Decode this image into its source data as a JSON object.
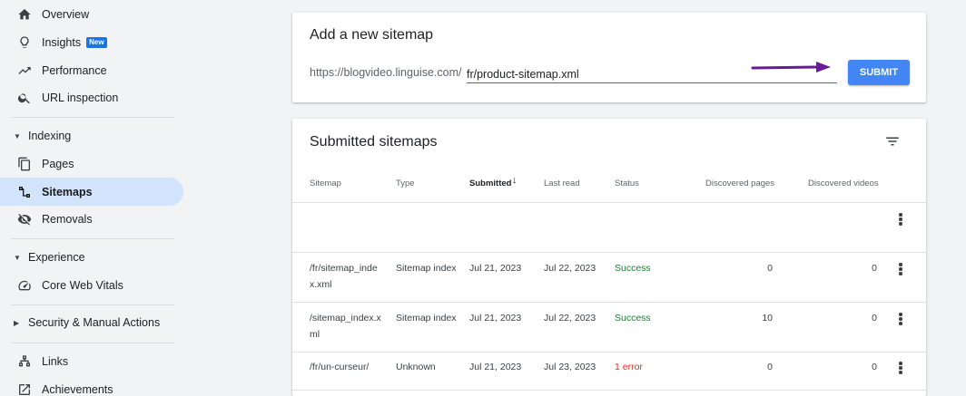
{
  "sidebar": {
    "overview": "Overview",
    "insights": "Insights",
    "insights_badge": "New",
    "performance": "Performance",
    "url_inspection": "URL inspection",
    "indexing": "Indexing",
    "pages": "Pages",
    "sitemaps": "Sitemaps",
    "removals": "Removals",
    "experience": "Experience",
    "core_web_vitals": "Core Web Vitals",
    "security": "Security & Manual Actions",
    "links": "Links",
    "achievements": "Achievements"
  },
  "add_sitemap": {
    "title": "Add a new sitemap",
    "prefix": "https://blogvideo.linguise.com/",
    "input_value": "fr/product-sitemap.xml",
    "submit_label": "SUBMIT"
  },
  "submitted": {
    "title": "Submitted sitemaps",
    "headers": {
      "sitemap": "Sitemap",
      "type": "Type",
      "submitted": "Submitted",
      "last_read": "Last read",
      "status": "Status",
      "discovered_pages": "Discovered pages",
      "discovered_videos": "Discovered videos"
    },
    "rows": [
      {
        "sitemap_line1": "/fr/sitemap_inde",
        "sitemap_line2": "x.xml",
        "type": "Sitemap index",
        "submitted": "Jul 21, 2023",
        "last_read": "Jul 22, 2023",
        "status": "Success",
        "pages": "0",
        "videos": "0"
      },
      {
        "sitemap_line1": "/sitemap_index.x",
        "sitemap_line2": "ml",
        "type": "Sitemap index",
        "submitted": "Jul 21, 2023",
        "last_read": "Jul 22, 2023",
        "status": "Success",
        "pages": "10",
        "videos": "0"
      },
      {
        "sitemap_line1": "/fr/un-curseur/",
        "sitemap_line2": "",
        "type": "Unknown",
        "submitted": "Jul 21, 2023",
        "last_read": "Jul 23, 2023",
        "status": "1 error",
        "pages": "0",
        "videos": "0"
      }
    ]
  },
  "colors": {
    "accent": "#1a73e8",
    "submit": "#4285f4",
    "active_nav": "#d2e3fc",
    "success": "#188038",
    "error": "#d93025",
    "arrow": "#6a1b9a"
  }
}
